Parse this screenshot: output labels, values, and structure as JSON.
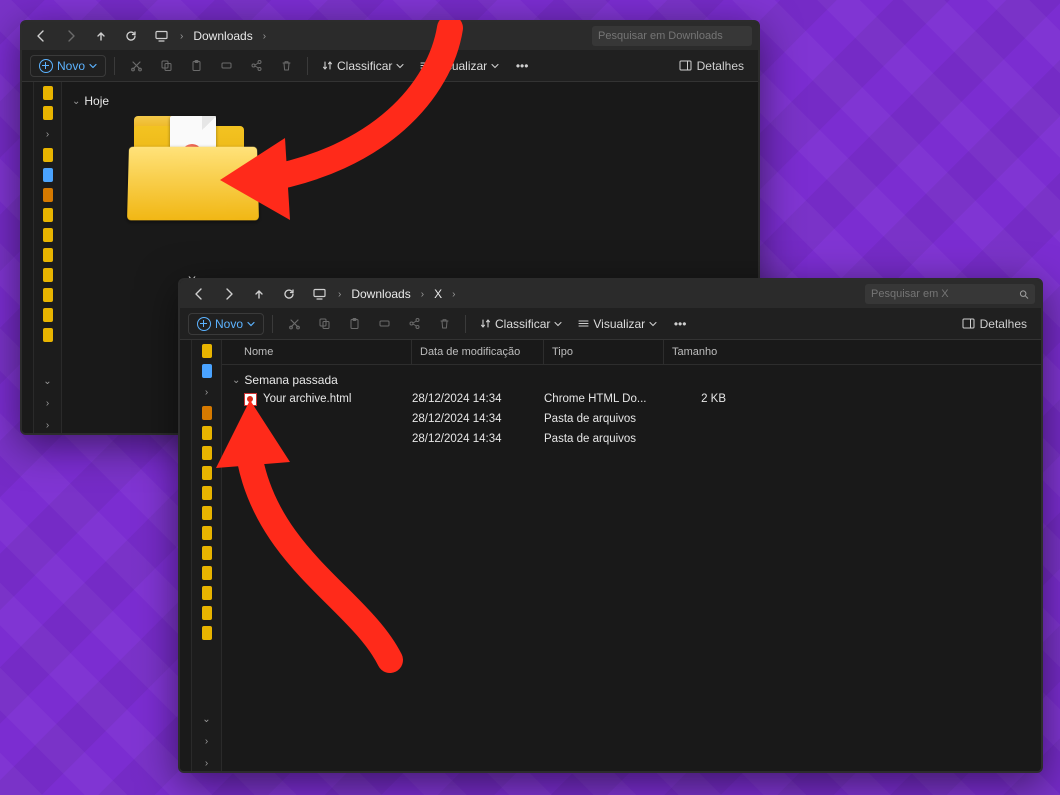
{
  "win1": {
    "breadcrumb": [
      "Downloads"
    ],
    "search_placeholder": "Pesquisar em Downloads",
    "new_label": "Novo",
    "sort_label": "Classificar",
    "view_label": "Visualizar",
    "details_label": "Detalhes",
    "group_label": "Hoje",
    "folder_label": "X",
    "nav_dots": [
      "#e8b400",
      "#e8b400",
      "#e8b400",
      "#4aa3ff",
      "#d67a00",
      "#e8b400",
      "#e8b400",
      "#e8b400",
      "#e8b400",
      "#e8b400",
      "#e8b400",
      "#e8b400"
    ]
  },
  "win2": {
    "breadcrumb": [
      "Downloads",
      "X"
    ],
    "search_placeholder": "Pesquisar em X",
    "new_label": "Novo",
    "sort_label": "Classificar",
    "view_label": "Visualizar",
    "details_label": "Detalhes",
    "columns": {
      "name": "Nome",
      "mod": "Data de modificação",
      "type": "Tipo",
      "size": "Tamanho"
    },
    "group_label": "Semana passada",
    "rows": [
      {
        "icon": "html",
        "name": "Your archive.html",
        "mod": "28/12/2024 14:34",
        "type": "Chrome HTML Do...",
        "size": "2 KB"
      },
      {
        "icon": "folder",
        "name": "",
        "mod": "28/12/2024 14:34",
        "type": "Pasta de arquivos",
        "size": ""
      },
      {
        "icon": "folder",
        "name": "",
        "mod": "28/12/2024 14:34",
        "type": "Pasta de arquivos",
        "size": ""
      }
    ],
    "nav_dots": [
      "#e8b400",
      "#4aa3ff",
      "#d67a00",
      "#e8b400",
      "#e8b400",
      "#e8b400",
      "#e8b400",
      "#e8b400",
      "#e8b400",
      "#e8b400",
      "#e8b400",
      "#e8b400",
      "#e8b400",
      "#e8b400"
    ]
  }
}
